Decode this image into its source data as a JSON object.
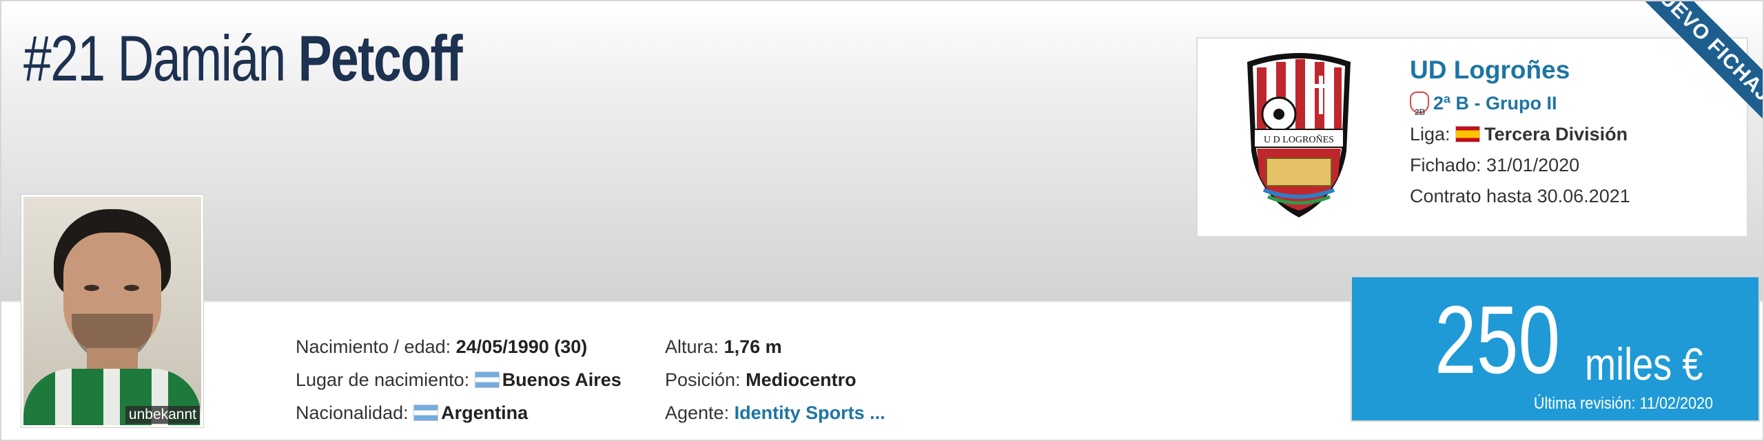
{
  "header": {
    "number": "#21",
    "first_name": "Damián",
    "last_name": "Petcoff"
  },
  "photo": {
    "caption": "unbekannt"
  },
  "info_left": {
    "birth_label": "Nacimiento / edad:",
    "birth_value": "24/05/1990 (30)",
    "birthplace_label": "Lugar de nacimiento:",
    "birthplace_value": "Buenos Aires",
    "nationality_label": "Nacionalidad:",
    "nationality_value": "Argentina"
  },
  "info_right": {
    "height_label": "Altura:",
    "height_value": "1,76 m",
    "position_label": "Posición:",
    "position_value": "Mediocentro",
    "agent_label": "Agente:",
    "agent_value": "Identity Sports ..."
  },
  "club": {
    "name": "UD Logroñes",
    "league_group": "2ª B - Grupo II",
    "league_label": "Liga:",
    "league_value": "Tercera División",
    "signed": "Fichado: 31/01/2020",
    "contract": "Contrato hasta 30.06.2021",
    "crest_text": "U D LOGROÑES",
    "ribbon": "NUEVO FICHAJE"
  },
  "market_value": {
    "amount": "250",
    "unit": "miles €",
    "last_revision": "Última revisión: 11/02/2020"
  },
  "colors": {
    "title": "#1d3150",
    "link": "#1d75a3",
    "value_bg": "#1f9ad6",
    "ribbon": "#1e5e8f"
  }
}
